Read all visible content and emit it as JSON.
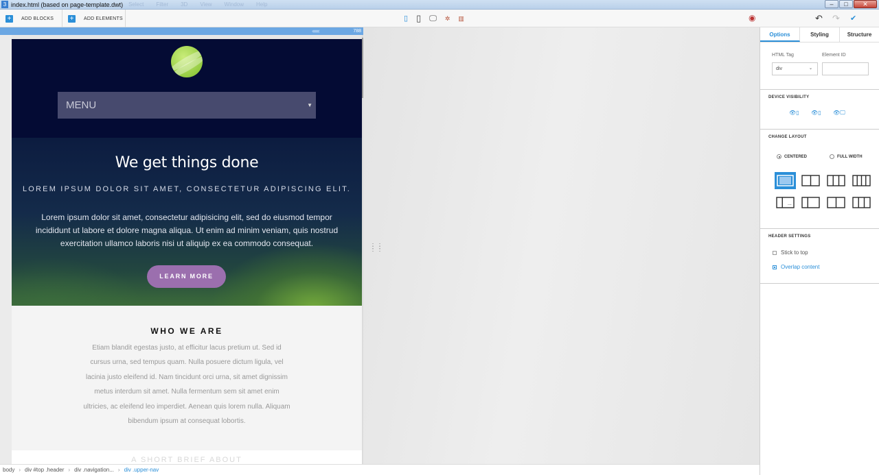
{
  "window": {
    "app_icon": "3",
    "title": "index.html (based on page-template.dwt)",
    "menu_ghost": [
      "Select",
      "Filter",
      "3D",
      "View",
      "Window",
      "Help"
    ],
    "controls": [
      "–",
      "□",
      "✕"
    ]
  },
  "toolbar": {
    "add_blocks_label": "ADD BLOCKS",
    "add_elements_label": "ADD ELEMENTS",
    "devices": [
      "mobile-icon",
      "tablet-icon",
      "desktop-icon",
      "gear-icon",
      "grid-icon"
    ],
    "device_glyphs": [
      "▯",
      "▯",
      "🖵",
      "✲",
      "▥"
    ],
    "active_device": 0,
    "preview_icon": "eye-icon",
    "undo_icon": "undo-icon",
    "redo_icon": "redo-icon",
    "confirm_icon": "checkmark-icon"
  },
  "ruler": {
    "chevrons": "‹‹‹‹‹‹‹‹‹‹",
    "width_label": "788"
  },
  "site": {
    "menu_label": "MENU",
    "hero_title": "We get things done",
    "hero_subtitle": "LOREM IPSUM DOLOR SIT AMET, CONSECTETUR ADIPISCING ELIT.",
    "hero_body": "Lorem ipsum dolor sit amet, consectetur adipisicing elit, sed do eiusmod tempor incididunt ut labore et dolore magna aliqua. Ut enim ad minim veniam, quis nostrud exercitation ullamco laboris nisi ut aliquip ex ea commodo consequat.",
    "hero_button": "LEARN MORE",
    "who_title": "WHO WE ARE",
    "who_body": "Etiam blandit egestas justo, at efficitur lacus pretium ut. Sed id cursus urna, sed tempus quam. Nulla posuere dictum ligula, vel lacinia justo eleifend id. Nam tincidunt orci urna, sit amet dignissim metus interdum sit amet. Nulla fermentum sem sit amet enim ultricies, ac eleifend leo imperdiet. Aenean quis lorem nulla. Aliquam bibendum ipsum at consequat lobortis.",
    "peek_title": "A SHORT BRIEF ABOUT"
  },
  "panel": {
    "tabs": [
      "Options",
      "Styling",
      "Structure"
    ],
    "active_tab": 0,
    "html_tag_label": "HTML Tag",
    "html_tag_value": "div",
    "element_id_label": "Element ID",
    "element_id_value": "",
    "device_visibility_title": "DEVICE VISIBILITY",
    "visibility_glyphs": [
      "👁▯",
      "👁▯",
      "👁🖵"
    ],
    "change_layout_title": "CHANGE LAYOUT",
    "layout_centered": "CENTERED",
    "layout_full_width": "FULL WIDTH",
    "layout_selected": "centered",
    "layout_options_count": 8,
    "active_layout": 0,
    "header_settings_title": "HEADER SETTINGS",
    "stick_to_top": "Stick to top",
    "stick_to_top_checked": false,
    "overlap_content": "Overlap content",
    "overlap_content_checked": true
  },
  "breadcrumb": [
    "body",
    "div #top .header",
    "div .navigation...",
    "div .upper-nav"
  ],
  "colors": {
    "accent": "#2b8fd8",
    "header_bg": "#040b34",
    "button": "#9b6fae",
    "logo": "#8bc53f"
  }
}
